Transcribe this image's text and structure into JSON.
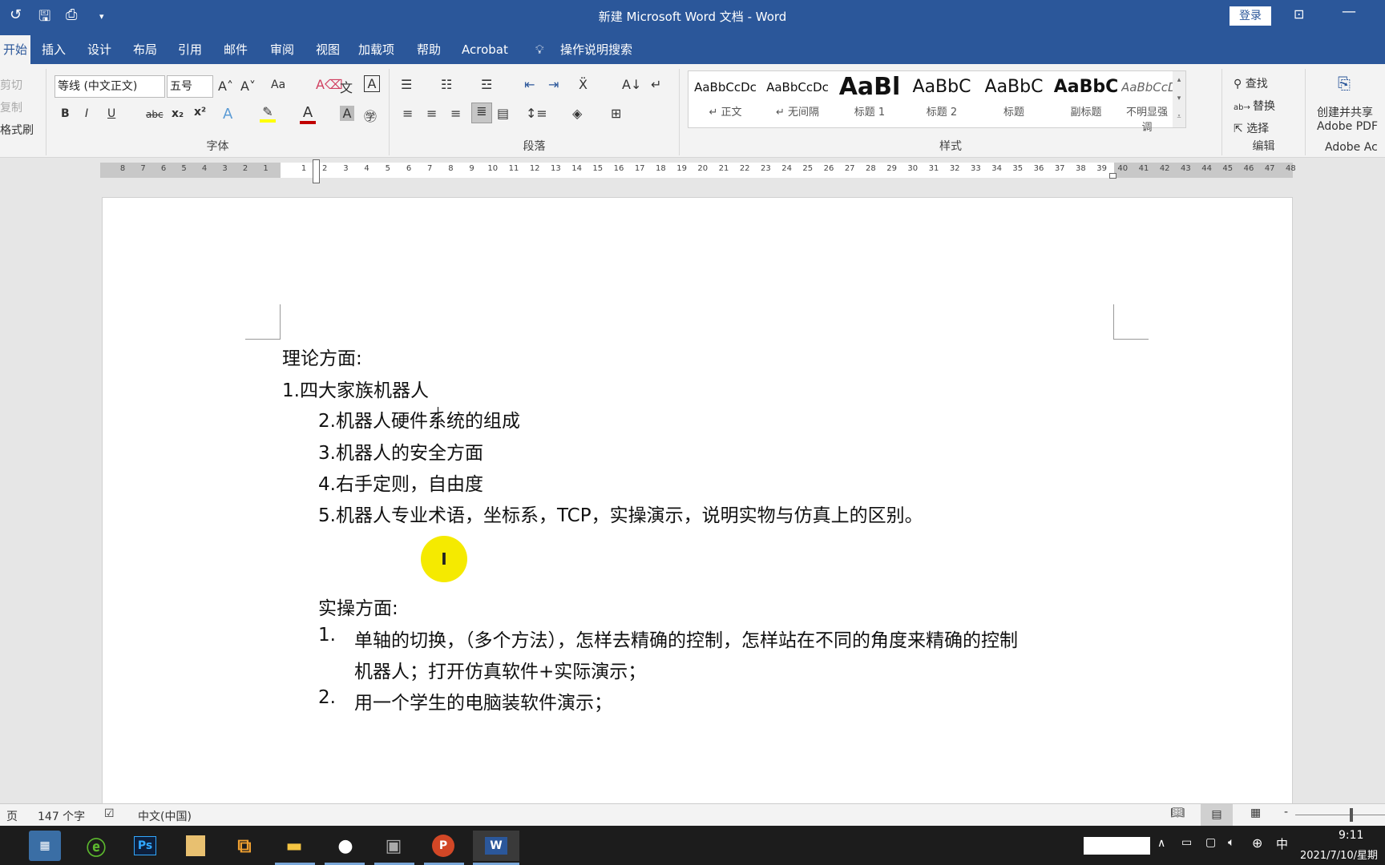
{
  "title": "新建 Microsoft Word 文档 - Word",
  "login": "登录",
  "tabs": [
    "开始",
    "插入",
    "设计",
    "布局",
    "引用",
    "邮件",
    "审阅",
    "视图",
    "加载项",
    "帮助",
    "Acrobat"
  ],
  "tell_me": "操作说明搜索",
  "clipboard": {
    "cut": "剪切",
    "copy": "复制",
    "format_painter": "格式刷"
  },
  "font": {
    "name": "等线 (中文正文)",
    "size": "五号",
    "group": "字体",
    "change_case": "Aa",
    "bold": "B",
    "italic": "I",
    "underline": "U",
    "strike": "abc",
    "sub": "x₂",
    "sup": "x²"
  },
  "paragraph": {
    "group": "段落"
  },
  "styles": {
    "group": "样式",
    "items": [
      {
        "sample": "AaBbCcDc",
        "name": "↵ 正文"
      },
      {
        "sample": "AaBbCcDc",
        "name": "↵ 无间隔"
      },
      {
        "sample": "AaBl",
        "name": "标题 1"
      },
      {
        "sample": "AaBbC",
        "name": "标题 2"
      },
      {
        "sample": "AaBbC",
        "name": "标题"
      },
      {
        "sample": "AaBbC",
        "name": "副标题"
      },
      {
        "sample": "AaBbCcDc",
        "name": "不明显强调"
      }
    ]
  },
  "editing": {
    "find": "查找",
    "replace": "替换",
    "select": "选择",
    "group": "编辑"
  },
  "adobe": {
    "create_share": "创建并共享",
    "pdf": "Adobe PDF",
    "group": "Adobe Ac"
  },
  "ruler": {
    "left": [
      "8",
      "7",
      "6",
      "5",
      "4",
      "3",
      "2",
      "1"
    ],
    "right": [
      "1",
      "2",
      "3",
      "4",
      "5",
      "6",
      "7",
      "8",
      "9",
      "10",
      "11",
      "12",
      "13",
      "14",
      "15",
      "16",
      "17",
      "18",
      "19",
      "20",
      "21",
      "22",
      "23",
      "24",
      "25",
      "26",
      "27",
      "28",
      "29",
      "30",
      "31",
      "32",
      "33",
      "34",
      "35",
      "36",
      "37",
      "38",
      "39",
      "40",
      "41",
      "42",
      "43",
      "44",
      "45",
      "46",
      "47",
      "48"
    ]
  },
  "document": {
    "l1": "理论方面:",
    "l2": "1.四大家族机器人",
    "l3": "2.机器人硬件系统的组成",
    "l4": "3.机器人的安全方面",
    "l5": "4.右手定则，自由度",
    "l6": "5.机器人专业术语，坐标系，TCP，实操演示，说明实物与仿真上的区别。",
    "l7": "实操方面:",
    "n1": "1.",
    "l8": "单轴的切换，（多个方法），怎样去精确的控制，怎样站在不同的角度来精确的控制",
    "l9": "机器人；打开仿真软件+实际演示；",
    "n2": "2.",
    "l10": "用一个学生的电脑装软件演示；"
  },
  "status": {
    "page": "页",
    "words": "147 个字",
    "lang": "中文(中国)"
  },
  "taskbar": {
    "time": "9:11",
    "date": "2021/7/10/星期",
    "ime": "中",
    "apps": [
      "calculator",
      "360-browser",
      "photoshop",
      "paint",
      "app-5",
      "file-explorer",
      "qq",
      "app-8",
      "powerpoint",
      "word"
    ]
  },
  "colors": {
    "accent": "#2b579a",
    "highlight": "#ffff00",
    "font_color": "#c00000"
  }
}
